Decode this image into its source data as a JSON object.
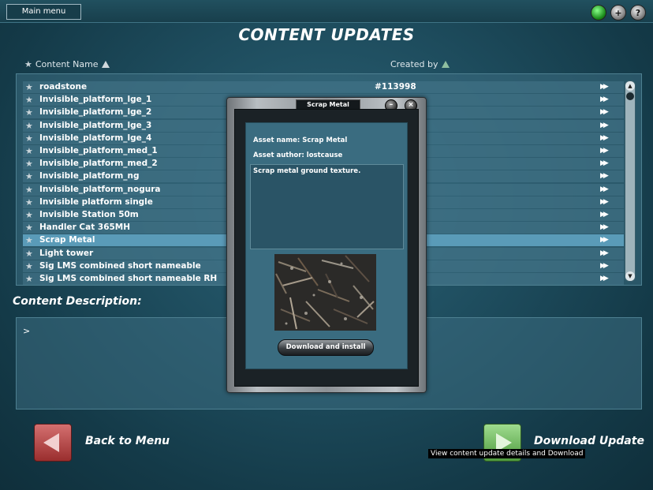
{
  "topbar": {
    "main_menu_label": "Main menu",
    "icons": [
      "status-green-icon",
      "plus-icon",
      "help-icon"
    ],
    "plus_glyph": "+",
    "help_glyph": "?"
  },
  "page_title": "CONTENT UPDATES",
  "columns": {
    "content_name": "Content Name",
    "created_by": "Created by"
  },
  "list": {
    "rows": [
      {
        "name": "roadstone",
        "id": "#113998",
        "selected": false
      },
      {
        "name": "Invisible_platform_lge_1",
        "id": "",
        "selected": false
      },
      {
        "name": "Invisible_platform_lge_2",
        "id": "",
        "selected": false
      },
      {
        "name": "Invisible_platform_lge_3",
        "id": "",
        "selected": false
      },
      {
        "name": "Invisible_platform_lge_4",
        "id": "",
        "selected": false
      },
      {
        "name": "Invisible_platform_med_1",
        "id": "",
        "selected": false
      },
      {
        "name": "Invisible_platform_med_2",
        "id": "",
        "selected": false
      },
      {
        "name": "Invisible_platform_ng",
        "id": "",
        "selected": false
      },
      {
        "name": "Invisible_platform_nogura",
        "id": "",
        "selected": false
      },
      {
        "name": "Invisible platform single",
        "id": "",
        "selected": false
      },
      {
        "name": "Invisible Station 50m",
        "id": "",
        "selected": false
      },
      {
        "name": "Handler Cat 365MH",
        "id": "",
        "selected": false
      },
      {
        "name": "Scrap Metal",
        "id": "",
        "selected": true
      },
      {
        "name": "Light tower",
        "id": "",
        "selected": false
      },
      {
        "name": "Sig LMS combined short nameable",
        "id": "",
        "selected": false
      },
      {
        "name": "Sig LMS combined short nameable RH",
        "id": "",
        "selected": false
      }
    ],
    "arrow_glyph": "▶▶"
  },
  "description": {
    "title": "Content Description:",
    "text": ">"
  },
  "footer": {
    "back_label": "Back to Menu",
    "download_label": "Download Update",
    "tooltip": "View content update details and Download"
  },
  "popup": {
    "title": "Scrap Metal",
    "minimize_glyph": "–",
    "close_glyph": "×",
    "asset_name": "Asset name: Scrap Metal",
    "asset_author": "Asset author: lostcause",
    "asset_description": "Scrap metal ground texture.",
    "download_install_label": "Download and install"
  },
  "colors": {
    "selected_row": "#5a9bb8",
    "background": "#1d4b5c"
  }
}
